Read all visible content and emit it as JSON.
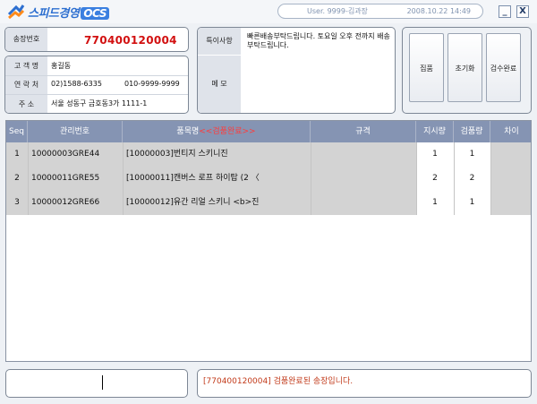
{
  "app": {
    "logo_text": "스피드경영",
    "logo_suffix": "OCS"
  },
  "user_info": {
    "user": "User. 9999-김과장",
    "datetime": "2008.10.22 14:49"
  },
  "window_buttons": {
    "minimize": "_",
    "close": "X"
  },
  "invoice": {
    "label": "송장번호",
    "number": "770400120004"
  },
  "customer": {
    "name_label": "고 객 명",
    "name": "홍길동",
    "contact_label": "연 락 처",
    "phone1": "02)1588-6335",
    "phone2": "010-9999-9999",
    "address_label": "주   소",
    "address": "서울 성동구 금호동3가 1111-1"
  },
  "notes": {
    "special_label": "특이사항",
    "special_text": "빠른배송부탁드립니다. 토요일 오후 전까지 배송 부탁드립니다.",
    "memo_label": "메   모",
    "memo_text": ""
  },
  "actions": {
    "pick": "집품",
    "reset": "초기화",
    "complete": "검수완료"
  },
  "grid": {
    "columns": {
      "seq": "Seq",
      "mgmt_no": "관리번호",
      "item_name": "품목명",
      "item_status": "<<검품완료>>",
      "spec": "규격",
      "instructed_qty": "지시량",
      "inspected_qty": "검품량",
      "diff": "차이"
    },
    "rows": [
      {
        "seq": "1",
        "mgmt_no": "10000003GRE44",
        "item": "[10000003]번티지 스키니진",
        "spec": "",
        "instructed": "1",
        "inspected": "1",
        "diff": ""
      },
      {
        "seq": "2",
        "mgmt_no": "10000011GRE55",
        "item": "[10000011]캔버스 로프 하이탑          (2 〈",
        "spec": "",
        "instructed": "2",
        "inspected": "2",
        "diff": ""
      },
      {
        "seq": "3",
        "mgmt_no": "10000012GRE66",
        "item": "[10000012]유간 리얼 스키니          <b>진",
        "spec": "",
        "instructed": "1",
        "inspected": "1",
        "diff": ""
      }
    ]
  },
  "scan_input": {
    "value": ""
  },
  "status_message": "[770400120004] 검품완료된 송장입니다.",
  "colors": {
    "accent": "#2d6fd0",
    "invoice_red": "#d21010",
    "header_bg": "#8594b3",
    "row_gray": "#d3d3d3",
    "message": "#c23a1a"
  }
}
